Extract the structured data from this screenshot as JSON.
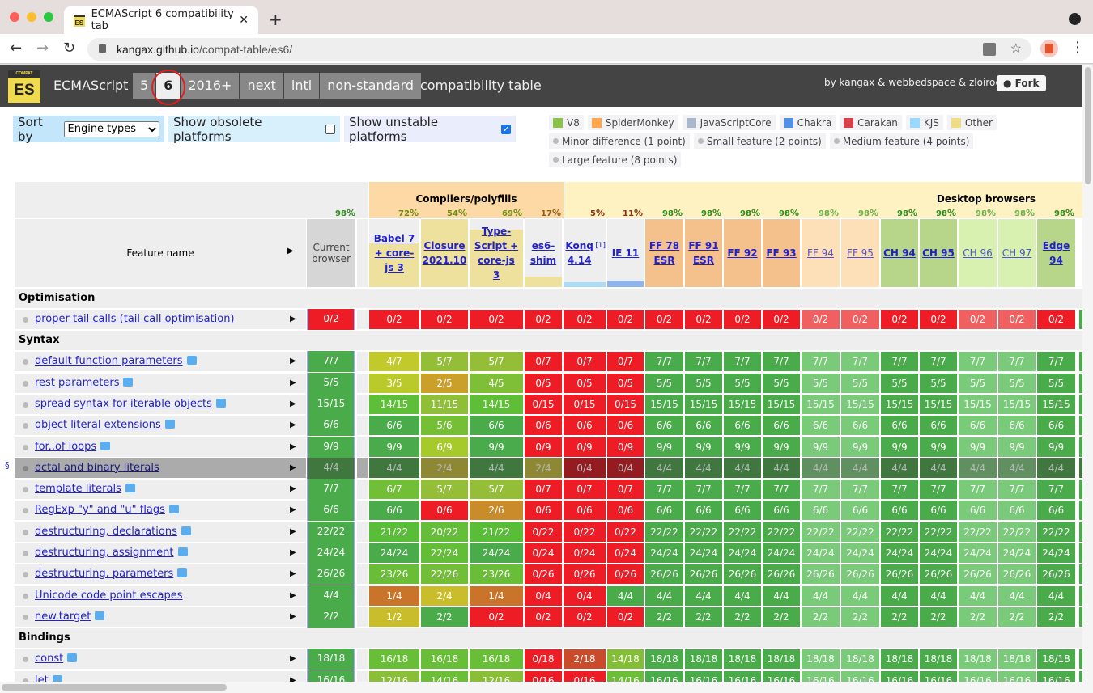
{
  "browser": {
    "tab_title": "ECMAScript 6 compatibility tab",
    "url_host": "kangax.github.io",
    "url_path": "/compat-table/es6/"
  },
  "header": {
    "logo_small": "COMPAT",
    "logo": "ES",
    "title": "ECMAScript",
    "tabs": [
      "5",
      "6",
      "2016+",
      "next",
      "intl",
      "non-standard"
    ],
    "active_tab": "6",
    "subtitle": "compatibility table",
    "by": "by",
    "authors": [
      "kangax",
      "webbedspace",
      "zloirock"
    ],
    "amp": "&",
    "fork": "Fork"
  },
  "controls": {
    "sort_label": "Sort by",
    "sort_value": "Engine types",
    "obsolete_label": "Show obsolete platforms",
    "obsolete_checked": false,
    "unstable_label": "Show unstable platforms",
    "unstable_checked": true
  },
  "legend": {
    "engines": [
      {
        "name": "V8",
        "color": "#8bc34a"
      },
      {
        "name": "SpiderMonkey",
        "color": "#ffa64d"
      },
      {
        "name": "JavaScriptCore",
        "color": "#aab8cc"
      },
      {
        "name": "Chakra",
        "color": "#5290e8"
      },
      {
        "name": "Carakan",
        "color": "#d8404a"
      },
      {
        "name": "KJS",
        "color": "#99d8ff"
      },
      {
        "name": "Other",
        "color": "#f0dc82"
      }
    ],
    "sizes": [
      "Minor difference (1 point)",
      "Small feature (2 points)",
      "Medium feature (4 points)",
      "Large feature (8 points)"
    ]
  },
  "table": {
    "groups": [
      "Compilers/polyfills",
      "Desktop browsers"
    ],
    "feature_header": "Feature name",
    "current": {
      "label": "Current browser",
      "pct": "98"
    },
    "columns": [
      {
        "label": "Babel 7 + core-js 3",
        "pct": "72",
        "bg": "#eee19e",
        "bar": 0.65
      },
      {
        "label": "Closure 2021.10",
        "pct": "54",
        "bg": "#eee19e",
        "bar": 1
      },
      {
        "label": "Type-Script + core-js 3",
        "pct": "69",
        "bg": "#eee19e",
        "bar": 0.85
      },
      {
        "label": "es6-shim",
        "pct": "17",
        "bg": "#eee19e",
        "bar": 0.15
      },
      {
        "label": "Konq 4.14",
        "sup": "[1]",
        "pct": "5",
        "bg": "#a8dcf8",
        "bar": 0.07
      },
      {
        "label": "IE 11",
        "pct": "11",
        "bg": "#8fb3ec",
        "bar": 0.1
      },
      {
        "label": "FF 78 ESR",
        "pct": "98",
        "bg": "#f4c08c",
        "bar": 1
      },
      {
        "label": "FF 91 ESR",
        "pct": "98",
        "bg": "#f4c08c",
        "bar": 1
      },
      {
        "label": "FF 92",
        "pct": "98",
        "bg": "#f4c08c",
        "bar": 1
      },
      {
        "label": "FF 93",
        "pct": "98",
        "bg": "#f4c08c",
        "bar": 1
      },
      {
        "label": "FF 94",
        "pct": "98",
        "bg": "#fde0b8",
        "bar": 1,
        "unstable": true
      },
      {
        "label": "FF 95",
        "pct": "98",
        "bg": "#fde0b8",
        "bar": 1,
        "unstable": true
      },
      {
        "label": "CH 94",
        "pct": "98",
        "bg": "#b8d68a",
        "bar": 1
      },
      {
        "label": "CH 95",
        "pct": "98",
        "bg": "#b8d68a",
        "bar": 1
      },
      {
        "label": "CH 96",
        "pct": "98",
        "bg": "#d8f0b0",
        "bar": 1,
        "unstable": true
      },
      {
        "label": "CH 97",
        "pct": "98",
        "bg": "#d8f0b0",
        "bar": 1,
        "unstable": true
      },
      {
        "label": "Edge 94",
        "pct": "98",
        "bg": "#b8d68a",
        "bar": 1
      }
    ],
    "sections": [
      {
        "title": "Optimisation",
        "rows": [
          {
            "name": "proper tail calls (tail call optimisation)",
            "note": false,
            "current": "0/2",
            "cells": [
              "0/2",
              "0/2",
              "0/2",
              "0/2",
              "0/2",
              "0/2",
              "0/2",
              "0/2",
              "0/2",
              "0/2",
              "0/2",
              "0/2",
              "0/2",
              "0/2",
              "0/2",
              "0/2",
              "0/2"
            ]
          }
        ]
      },
      {
        "title": "Syntax",
        "rows": [
          {
            "name": "default function parameters",
            "note": true,
            "current": "7/7",
            "cells": [
              "4/7",
              "5/7",
              "5/7",
              "0/7",
              "0/7",
              "0/7",
              "7/7",
              "7/7",
              "7/7",
              "7/7",
              "7/7",
              "7/7",
              "7/7",
              "7/7",
              "7/7",
              "7/7",
              "7/7"
            ]
          },
          {
            "name": "rest parameters",
            "note": true,
            "current": "5/5",
            "cells": [
              "3/5",
              "2/5",
              "4/5",
              "0/5",
              "0/5",
              "0/5",
              "5/5",
              "5/5",
              "5/5",
              "5/5",
              "5/5",
              "5/5",
              "5/5",
              "5/5",
              "5/5",
              "5/5",
              "5/5"
            ]
          },
          {
            "name": "spread syntax for iterable objects",
            "note": true,
            "current": "15/15",
            "cells": [
              "14/15",
              "11/15",
              "14/15",
              "0/15",
              "0/15",
              "0/15",
              "15/15",
              "15/15",
              "15/15",
              "15/15",
              "15/15",
              "15/15",
              "15/15",
              "15/15",
              "15/15",
              "15/15",
              "15/15"
            ]
          },
          {
            "name": "object literal extensions",
            "note": true,
            "current": "6/6",
            "cells": [
              "6/6",
              "5/6",
              "6/6",
              "0/6",
              "0/6",
              "0/6",
              "6/6",
              "6/6",
              "6/6",
              "6/6",
              "6/6",
              "6/6",
              "6/6",
              "6/6",
              "6/6",
              "6/6",
              "6/6"
            ]
          },
          {
            "name": "for..of loops",
            "note": true,
            "current": "9/9",
            "cells": [
              "9/9",
              "6/9",
              "9/9",
              "0/9",
              "0/9",
              "0/9",
              "9/9",
              "9/9",
              "9/9",
              "9/9",
              "9/9",
              "9/9",
              "9/9",
              "9/9",
              "9/9",
              "9/9",
              "9/9"
            ]
          },
          {
            "name": "octal and binary literals",
            "note": false,
            "hover": true,
            "current": "4/4",
            "cells": [
              "4/4",
              "2/4",
              "4/4",
              "2/4",
              "0/4",
              "0/4",
              "4/4",
              "4/4",
              "4/4",
              "4/4",
              "4/4",
              "4/4",
              "4/4",
              "4/4",
              "4/4",
              "4/4",
              "4/4"
            ]
          },
          {
            "name": "template literals",
            "note": true,
            "current": "7/7",
            "cells": [
              "6/7",
              "5/7",
              "5/7",
              "0/7",
              "0/7",
              "0/7",
              "7/7",
              "7/7",
              "7/7",
              "7/7",
              "7/7",
              "7/7",
              "7/7",
              "7/7",
              "7/7",
              "7/7",
              "7/7"
            ]
          },
          {
            "name": "RegExp \"y\" and \"u\" flags",
            "note": true,
            "current": "6/6",
            "cells": [
              "6/6",
              "0/6",
              "2/6",
              "0/6",
              "0/6",
              "0/6",
              "6/6",
              "6/6",
              "6/6",
              "6/6",
              "6/6",
              "6/6",
              "6/6",
              "6/6",
              "6/6",
              "6/6",
              "6/6"
            ]
          },
          {
            "name": "destructuring, declarations",
            "note": true,
            "current": "22/22",
            "cells": [
              "21/22",
              "20/22",
              "21/22",
              "0/22",
              "0/22",
              "0/22",
              "22/22",
              "22/22",
              "22/22",
              "22/22",
              "22/22",
              "22/22",
              "22/22",
              "22/22",
              "22/22",
              "22/22",
              "22/22"
            ]
          },
          {
            "name": "destructuring, assignment",
            "note": true,
            "current": "24/24",
            "cells": [
              "24/24",
              "22/24",
              "24/24",
              "0/24",
              "0/24",
              "0/24",
              "24/24",
              "24/24",
              "24/24",
              "24/24",
              "24/24",
              "24/24",
              "24/24",
              "24/24",
              "24/24",
              "24/24",
              "24/24"
            ]
          },
          {
            "name": "destructuring, parameters",
            "note": true,
            "current": "26/26",
            "cells": [
              "23/26",
              "22/26",
              "23/26",
              "0/26",
              "0/26",
              "0/26",
              "26/26",
              "26/26",
              "26/26",
              "26/26",
              "26/26",
              "26/26",
              "26/26",
              "26/26",
              "26/26",
              "26/26",
              "26/26"
            ]
          },
          {
            "name": "Unicode code point escapes",
            "note": false,
            "current": "4/4",
            "cells": [
              "1/4",
              "2/4",
              "1/4",
              "0/4",
              "0/4",
              "4/4",
              "4/4",
              "4/4",
              "4/4",
              "4/4",
              "4/4",
              "4/4",
              "4/4",
              "4/4",
              "4/4",
              "4/4",
              "4/4"
            ]
          },
          {
            "name": "new.target",
            "note": true,
            "current": "2/2",
            "cells": [
              "1/2",
              "2/2",
              "0/2",
              "0/2",
              "0/2",
              "0/2",
              "2/2",
              "2/2",
              "2/2",
              "2/2",
              "2/2",
              "2/2",
              "2/2",
              "2/2",
              "2/2",
              "2/2",
              "2/2"
            ]
          }
        ]
      },
      {
        "title": "Bindings",
        "rows": [
          {
            "name": "const",
            "note": true,
            "current": "18/18",
            "cells": [
              "16/18",
              "16/18",
              "16/18",
              "0/18",
              "2/18",
              "14/18",
              "18/18",
              "18/18",
              "18/18",
              "18/18",
              "18/18",
              "18/18",
              "18/18",
              "18/18",
              "18/18",
              "18/18",
              "18/18"
            ]
          },
          {
            "name": "let",
            "note": true,
            "current": "16/16",
            "cells": [
              "12/16",
              "14/16",
              "12/16",
              "0/16",
              "0/16",
              "14/16",
              "16/16",
              "16/16",
              "16/16",
              "16/16",
              "16/16",
              "16/16",
              "16/16",
              "16/16",
              "16/16",
              "16/16",
              "16/16"
            ]
          }
        ]
      }
    ],
    "section_mark": "§"
  }
}
